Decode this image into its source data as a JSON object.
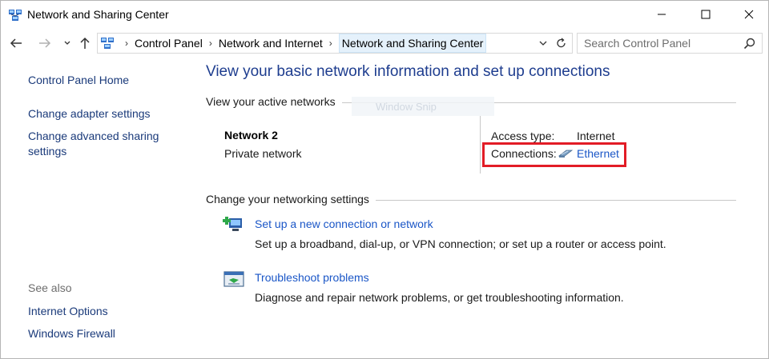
{
  "window": {
    "title": "Network and Sharing Center",
    "icon": "network-globe-icon"
  },
  "nav": {
    "breadcrumbs": [
      "Control Panel",
      "Network and Internet",
      "Network and Sharing Center"
    ],
    "search_placeholder": "Search Control Panel"
  },
  "sidebar": {
    "home": "Control Panel Home",
    "links": [
      "Change adapter settings",
      "Change advanced sharing",
      "settings"
    ],
    "see_also_label": "See also",
    "see_also": [
      "Internet Options",
      "Windows Firewall"
    ]
  },
  "main": {
    "title": "View your basic network information and set up connections",
    "active_networks_heading": "View your active networks",
    "ghost_caption": "Window Snip",
    "network": {
      "name": "Network  2",
      "type": "Private network",
      "access_type_label": "Access type:",
      "access_type_value": "Internet",
      "connections_label": "Connections:",
      "connection_name": "Ethernet"
    },
    "settings_heading": "Change your networking settings",
    "tasks": [
      {
        "link": "Set up a new connection or network",
        "description": "Set up a broadband, dial-up, or VPN connection; or set up a router or access point.",
        "icon": "new-connection-icon"
      },
      {
        "link": "Troubleshoot problems",
        "description": "Diagnose and repair network problems, or get troubleshooting information.",
        "icon": "troubleshoot-icon"
      }
    ]
  },
  "colors": {
    "link": "#1a56c7",
    "title": "#1e3d8f",
    "highlight": "#e21c26"
  }
}
